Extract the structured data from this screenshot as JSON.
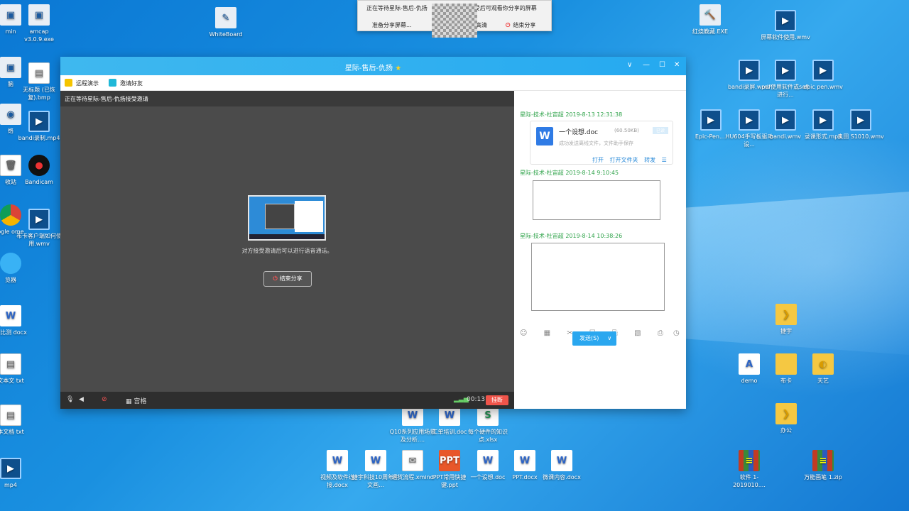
{
  "desktop": {
    "icons": [
      {
        "label": "min",
        "kind": "app",
        "glyph": "▣"
      },
      {
        "label": "amcap v3.0.9.exe",
        "kind": "app",
        "glyph": "▣"
      },
      {
        "label": "WhiteBoard",
        "kind": "app",
        "glyph": "✎"
      },
      {
        "label": "脑",
        "kind": "app",
        "glyph": "▣"
      },
      {
        "label": "无标题 (已恢复).bmp",
        "kind": "txt",
        "glyph": "▤"
      },
      {
        "label": "络",
        "kind": "app",
        "glyph": "◉"
      },
      {
        "label": "bandi录制.mp4",
        "kind": "video",
        "glyph": "▶"
      },
      {
        "label": "收站",
        "kind": "txt",
        "glyph": "🗑"
      },
      {
        "label": "Bandicam",
        "kind": "rec",
        "glyph": "●"
      },
      {
        "label": "ogle ome",
        "kind": "chrome",
        "glyph": ""
      },
      {
        "label": "布卡客户端如何使用.wmv",
        "kind": "video",
        "glyph": "▶"
      },
      {
        "label": "览器",
        "kind": "cloud",
        "glyph": ""
      },
      {
        "label": "对比测 docx",
        "kind": "doc",
        "glyph": "W"
      },
      {
        "label": "文本文 txt",
        "kind": "txt",
        "glyph": "▤"
      },
      {
        "label": "本文档 txt",
        "kind": "txt",
        "glyph": "▤"
      },
      {
        "label": "mp4",
        "kind": "video",
        "glyph": "▶"
      },
      {
        "label": "红烧教藏.EXE",
        "kind": "app",
        "glyph": "🔨"
      },
      {
        "label": "屏幕软件使用.wmv",
        "kind": "video",
        "glyph": "▶"
      },
      {
        "label": "bandi录屏.wmv",
        "kind": "video",
        "glyph": "▶"
      },
      {
        "label": "pdf使用软件或soft进行...",
        "kind": "video",
        "glyph": "▶"
      },
      {
        "label": "epic pen.wmv",
        "kind": "video",
        "glyph": "▶"
      },
      {
        "label": "Epic-Pen....",
        "kind": "video",
        "glyph": "▶"
      },
      {
        "label": "HU604手写板驱动设...",
        "kind": "video",
        "glyph": "▶"
      },
      {
        "label": "bandi.wmv",
        "kind": "video",
        "glyph": "▶"
      },
      {
        "label": "录课形式.mp4",
        "kind": "video",
        "glyph": "▶"
      },
      {
        "label": "良田 S1010.wmv",
        "kind": "video",
        "glyph": "▶"
      },
      {
        "label": "捷宇",
        "kind": "folder",
        "glyph": "❯"
      },
      {
        "label": "demo",
        "kind": "doc",
        "glyph": "A"
      },
      {
        "label": "布卡",
        "kind": "folder",
        "glyph": ""
      },
      {
        "label": "天艺",
        "kind": "folder",
        "glyph": "◐"
      },
      {
        "label": "办公",
        "kind": "folder",
        "glyph": "❯"
      },
      {
        "label": "Q10系列应用场景及分析....",
        "kind": "doc",
        "glyph": "W"
      },
      {
        "label": "工单培训.doc",
        "kind": "doc",
        "glyph": "W"
      },
      {
        "label": "每个硬件的知识点.xlsx",
        "kind": "xls",
        "glyph": "S"
      },
      {
        "label": "视频及软件连接.docx",
        "kind": "doc",
        "glyph": "W"
      },
      {
        "label": "捷宇科技10周年中文画...",
        "kind": "doc",
        "glyph": "W"
      },
      {
        "label": "退货流程.xmind",
        "kind": "txt",
        "glyph": "✉"
      },
      {
        "label": "PPT常用快捷键.ppt",
        "kind": "ppt",
        "glyph": "PPT"
      },
      {
        "label": "一个设想.doc",
        "kind": "doc",
        "glyph": "W"
      },
      {
        "label": "PPT.docx",
        "kind": "doc",
        "glyph": "W"
      },
      {
        "label": "微课内容.docx",
        "kind": "doc",
        "glyph": "W"
      },
      {
        "label": "软件 1-2019010....",
        "kind": "zip",
        "glyph": "≡"
      },
      {
        "label": "万能画笔 1.zip",
        "kind": "zip",
        "glyph": "≡"
      }
    ]
  },
  "notification": {
    "text": "正在等待星际-售后-仇扬",
    "text_tail": "受后可观看你分享的屏幕",
    "prepare": "准备分享屏幕...",
    "hd": "高清",
    "end_icon": "⏻",
    "end": "结束分享"
  },
  "window": {
    "title": "星际-售后-仇扬",
    "title_star": "★",
    "controls": [
      "∨",
      "—",
      "☐",
      "✕"
    ],
    "toolbar": {
      "remote": "远程演示",
      "invite": "邀请好友"
    },
    "share": {
      "header": "正在等待星际-售后-仇扬接受邀请",
      "message": "对方接受邀请后可以进行语音通话。",
      "end_button": "结束分享",
      "end_icon": "⏻",
      "layout_label": "宫格",
      "timer": "00:13",
      "hangup": "挂断"
    },
    "chat": {
      "msg1_sender": "星际-技术-杜宙超 2019-8-13 12:31:38",
      "file_name": "一个设想.doc",
      "file_size": "(60.50KB)",
      "file_status": "成功发送离线文件，文件助手保存",
      "file_tag": "已读",
      "file_actions": "打开 打开文件夹 转发 ☰",
      "msg2_sender": "星际-技术-杜宙超 2019-8-14 9:10:45",
      "msg3_sender": "星际-技术-杜宙超 2019-8-14 10:38:26",
      "tools": "☺ ▦ ✂ ☐ ⎘ ▧ ⎙",
      "history_icon": "◷",
      "send": "发送(S)",
      "send_arrow": "∨"
    }
  },
  "colors": {
    "titlebar": "#25a9f0",
    "hangup": "#f0544a",
    "accent_green": "#2fa34a"
  }
}
